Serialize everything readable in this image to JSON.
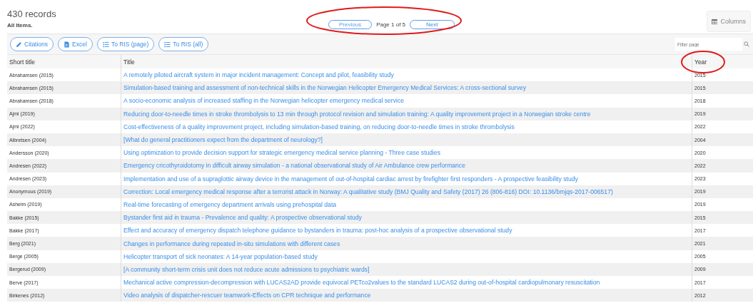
{
  "header": {
    "record_count": "430 records",
    "subtitle": "All Items."
  },
  "pagination": {
    "previous": "Previous",
    "page_info": "Page 1 of 5",
    "next": "Next"
  },
  "columns_button": "Columns",
  "toolbar": {
    "buttons": [
      {
        "kind": "pencil",
        "label": "Citations"
      },
      {
        "kind": "excel",
        "label": "Excel"
      },
      {
        "kind": "list",
        "label": "To RIS (page)"
      },
      {
        "kind": "list",
        "label": "To RIS (all)"
      }
    ],
    "filter": {
      "placeholder": "Filter page"
    }
  },
  "table": {
    "columns": [
      "Short title",
      "Title",
      "Year"
    ],
    "rows": [
      [
        "Abrahamsen (2015)",
        "A remotely piloted aircraft system in major incident management: Concept and pilot, feasibility study",
        "2015"
      ],
      [
        "Abrahamsen (2015)",
        "Simulation-based training and assessment of non-technical skills in the Norwegian Helicopter Emergency Medical Services: A cross-sectional survey",
        "2015"
      ],
      [
        "Abrahamsen (2018)",
        "A socio-economic analysis of increased staffing in the Norwegian helicopter emergency medical service",
        "2018"
      ],
      [
        "Ajmi (2019)",
        "Reducing door-to-needle times in stroke thrombolysis to 13 min through protocol revision and simulation training: A quality improvement project in a Norwegian stroke centre",
        "2019"
      ],
      [
        "Ajmi (2022)",
        "Cost-effectiveness of a quality improvement project, including simulation-based training, on reducing door-to-needle times in stroke thrombolysis",
        "2022"
      ],
      [
        "Albretsen (2004)",
        "[What do general practitioners expect from the department of neurology?]",
        "2004"
      ],
      [
        "Andersson (2020)",
        "Using optimization to provide decision support for strategic emergency medical service planning - Three case studies",
        "2020"
      ],
      [
        "Andresen (2022)",
        "Emergency cricothyroidotomy in difficult airway simulation - a national observational study of Air Ambulance crew performance",
        "2022"
      ],
      [
        "Andresen (2023)",
        "Implementation and use of a supraglottic airway device in the management of out-of-hospital cardiac arrest by firefighter first responders - A prospective feasibility study",
        "2023"
      ],
      [
        "Anonymous (2019)",
        "Correction: Local emergency medical response after a terrorist attack in Norway: A qualitative study (BMJ Quality and Safety (2017) 26 (806-816) DOI: 10.1136/bmjqs-2017-006517)",
        "2019"
      ],
      [
        "Asheim (2019)",
        "Real-time forecasting of emergency department arrivals using prehospital data",
        "2019"
      ],
      [
        "Bakke (2015)",
        "Bystander first aid in trauma - Prevalence and quality: A prospective observational study",
        "2015"
      ],
      [
        "Bakke (2017)",
        "Effect and accuracy of emergency dispatch telephone guidance to bystanders in trauma: post-hoc analysis of a prospective observational study",
        "2017"
      ],
      [
        "Berg (2021)",
        "Changes in performance during repeated in-situ simulations with different cases",
        "2021"
      ],
      [
        "Berge (2005)",
        "Helicopter transport of sick neonates: A 14-year population-based study",
        "2005"
      ],
      [
        "Bergerud (2009)",
        "[A community short-term crisis unit does not reduce acute admissions to psychiatric wards]",
        "2009"
      ],
      [
        "Berve (2017)",
        "Mechanical active compression-decompression with LUCAS2AD provide equivocal PETco2values to the standard LUCAS2 during out-of-hospital cardiopulmonary resuscitation",
        "2017"
      ],
      [
        "Birkenes (2012)",
        "Video analysis of dispatcher-rescuer teamwork-Effects on CPR technique and performance",
        "2012"
      ]
    ]
  }
}
